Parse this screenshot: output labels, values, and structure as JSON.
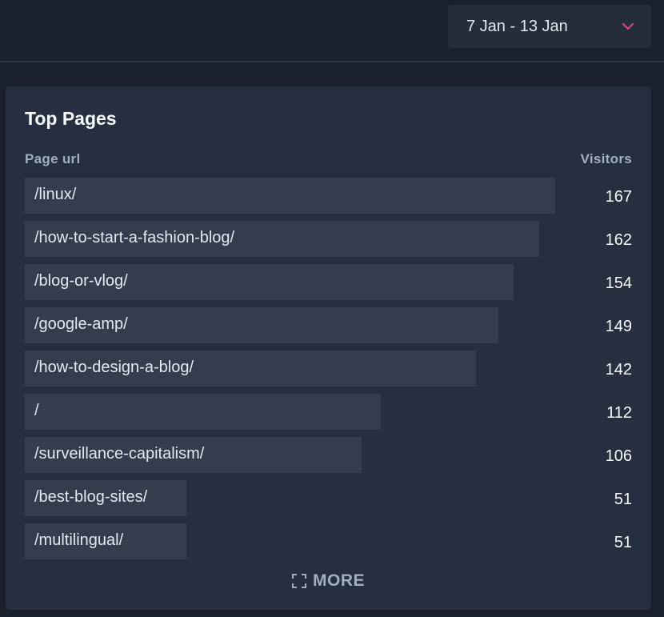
{
  "header": {
    "date_range": "7 Jan - 13 Jan",
    "chevron_icon": "chevron-down-icon",
    "accent_color": "#d53f8c"
  },
  "card": {
    "title": "Top Pages",
    "col_url": "Page url",
    "col_visitors": "Visitors",
    "rows": [
      {
        "url": "/linux/",
        "visitors": 167
      },
      {
        "url": "/how-to-start-a-fashion-blog/",
        "visitors": 162
      },
      {
        "url": "/blog-or-vlog/",
        "visitors": 154
      },
      {
        "url": "/google-amp/",
        "visitors": 149
      },
      {
        "url": "/how-to-design-a-blog/",
        "visitors": 142
      },
      {
        "url": "/",
        "visitors": 112
      },
      {
        "url": "/surveillance-capitalism/",
        "visitors": 106
      },
      {
        "url": "/best-blog-sites/",
        "visitors": 51
      },
      {
        "url": "/multilingual/",
        "visitors": 51
      }
    ],
    "more_label": "MORE",
    "more_icon": "expand-icon"
  }
}
